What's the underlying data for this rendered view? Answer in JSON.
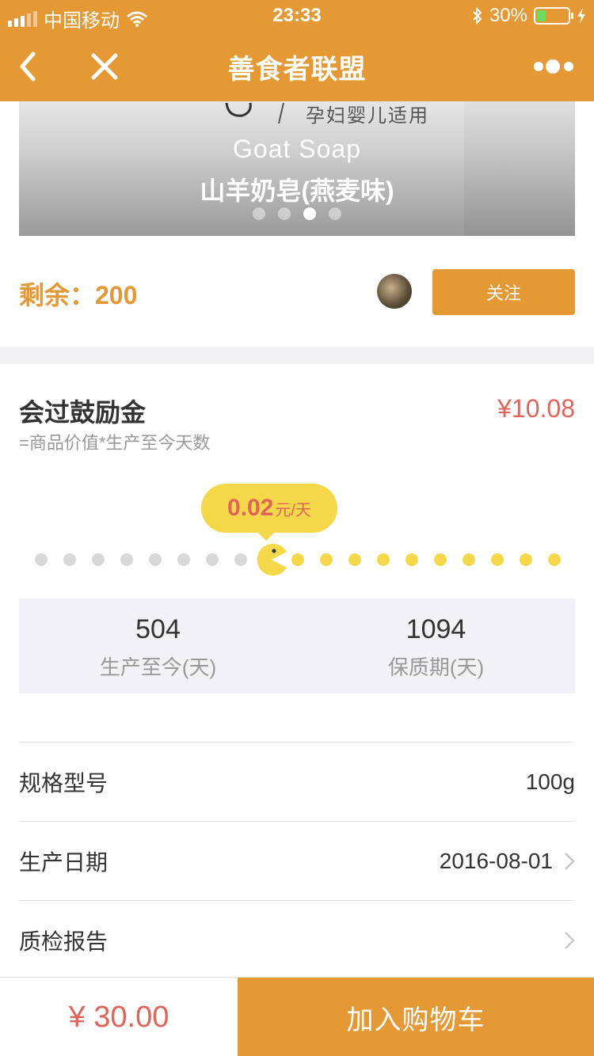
{
  "status_bar": {
    "carrier": "中国移动",
    "time": "23:33",
    "battery_percent": "30%",
    "battery_level": 0.3
  },
  "nav": {
    "title": "善食者联盟",
    "back_icon": "chevron-left-icon",
    "close_icon": "close-icon",
    "more_icon": "more-dots-icon"
  },
  "banner": {
    "deco_text": "孕妇婴儿适用",
    "title_en": "Goat Soap",
    "title_cn": "山羊奶皂(燕麦味)",
    "slide_count": 4,
    "active_slide": 3
  },
  "stock": {
    "remaining_label": "剩余：200",
    "follow_label": "关注"
  },
  "reward": {
    "title": "会过鼓励金",
    "amount": "¥10.08",
    "formula": "=商品价值*生产至今天数",
    "rate_value": "0.02",
    "rate_unit": "元/天",
    "progress_fraction": 0.46
  },
  "stats": [
    {
      "value": "504",
      "label": "生产至今(天)"
    },
    {
      "value": "1094",
      "label": "保质期(天)"
    }
  ],
  "details": [
    {
      "label": "规格型号",
      "value": "100g"
    },
    {
      "label": "生产日期",
      "value": "2016-08-01"
    },
    {
      "label": "质检报告",
      "value": ""
    }
  ],
  "bottom_bar": {
    "price": "¥ 30.00",
    "cart_label": "加入购物车"
  },
  "colors": {
    "brand": "#e59934",
    "price_red": "#e0645a",
    "pill_yellow": "#f5d84a"
  }
}
